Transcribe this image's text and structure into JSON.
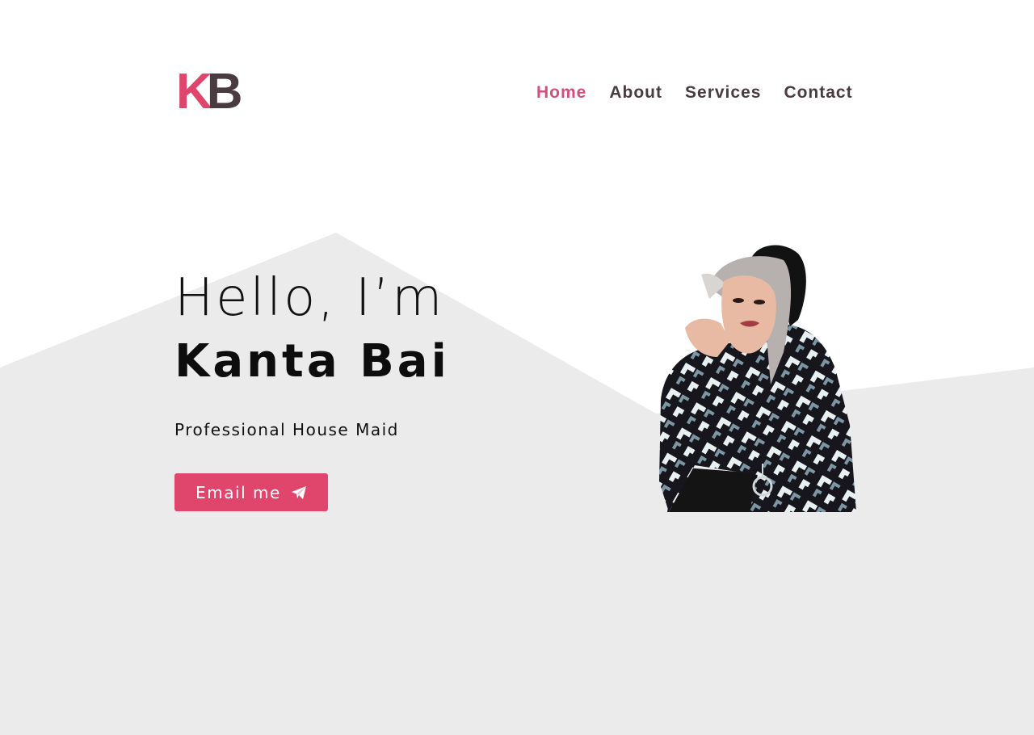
{
  "logo": {
    "letter_1": "K",
    "letter_2": "B",
    "colors": {
      "k": "#e0456c",
      "b": "#4a3b40"
    }
  },
  "nav": {
    "items": [
      {
        "label": "Home",
        "active": true
      },
      {
        "label": "About",
        "active": false
      },
      {
        "label": "Services",
        "active": false
      },
      {
        "label": "Contact",
        "active": false
      }
    ]
  },
  "hero": {
    "greeting": "Hello, I’m",
    "name": "Kanta Bai",
    "subtitle": "Professional House Maid",
    "cta_label": "Email me",
    "cta_icon": "paper-plane-icon"
  },
  "colors": {
    "accent": "#e0456c",
    "nav_text": "#4a3b40",
    "nav_active": "#d14f79",
    "background_shape": "#ebebeb",
    "text": "#111111"
  }
}
